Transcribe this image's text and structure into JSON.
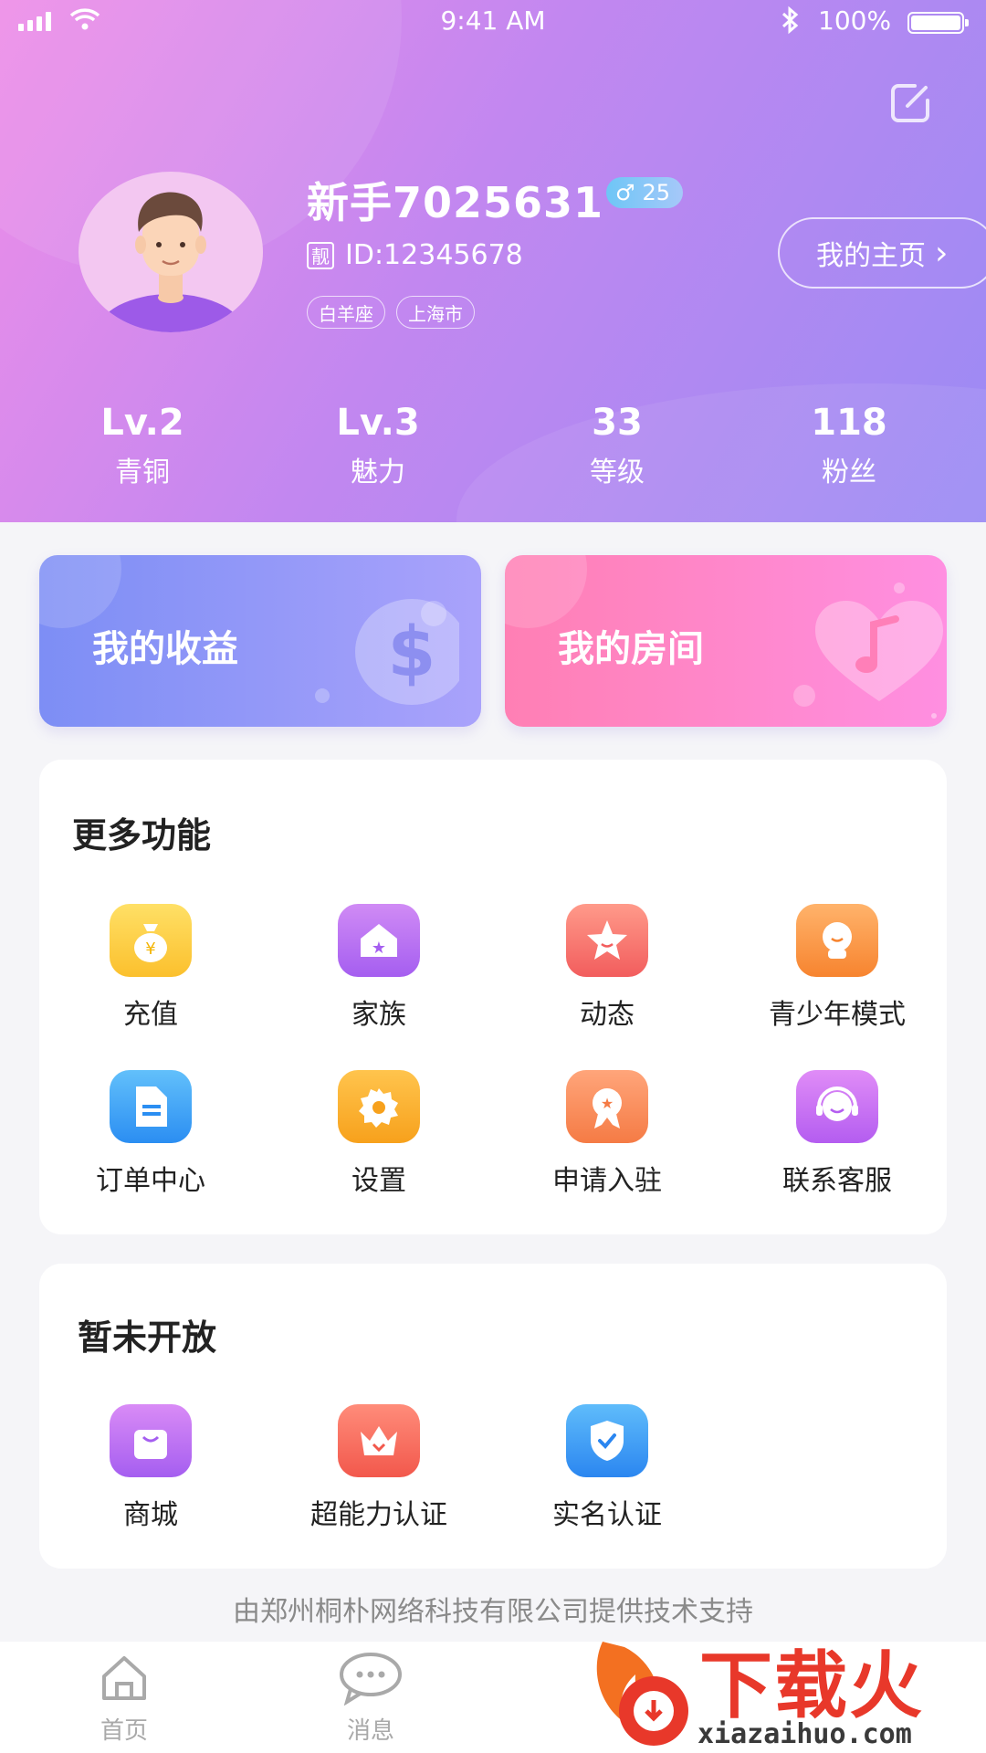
{
  "status_bar": {
    "time": "9:41 AM",
    "battery": "100%"
  },
  "profile": {
    "name": "新手7025631",
    "gender_symbol": "♂",
    "age": "25",
    "id_badge": "靓",
    "id_text": "ID:12345678",
    "tags": [
      "白羊座",
      "上海市"
    ],
    "homepage_label": "我的主页",
    "homepage_chevron": "›"
  },
  "stats": [
    {
      "value": "Lv.2",
      "label": "青铜"
    },
    {
      "value": "Lv.3",
      "label": "魅力"
    },
    {
      "value": "33",
      "label": "等级"
    },
    {
      "value": "118",
      "label": "粉丝"
    }
  ],
  "promos": {
    "earnings": "我的收益",
    "room": "我的房间"
  },
  "more_functions": {
    "title": "更多功能",
    "items": [
      {
        "label": "充值",
        "icon": "money-bag-icon"
      },
      {
        "label": "家族",
        "icon": "house-icon"
      },
      {
        "label": "动态",
        "icon": "star-icon"
      },
      {
        "label": "青少年模式",
        "icon": "youth-icon"
      },
      {
        "label": "订单中心",
        "icon": "document-icon"
      },
      {
        "label": "设置",
        "icon": "gear-icon"
      },
      {
        "label": "申请入驻",
        "icon": "medal-icon"
      },
      {
        "label": "联系客服",
        "icon": "headset-icon"
      }
    ]
  },
  "not_open": {
    "title": "暂未开放",
    "items": [
      {
        "label": "商城",
        "icon": "shopping-bag-icon"
      },
      {
        "label": "超能力认证",
        "icon": "crown-icon"
      },
      {
        "label": "实名认证",
        "icon": "shield-check-icon"
      }
    ]
  },
  "footer_note": "由郑州桐朴网络科技有限公司提供技术支持",
  "tabbar": [
    {
      "label": "首页",
      "icon": "home-icon"
    },
    {
      "label": "消息",
      "icon": "chat-icon"
    }
  ],
  "watermark": {
    "brand": "下载火",
    "url": "xiazaihuo.com"
  },
  "colors": {
    "header_start": "#ee8ee8",
    "header_end": "#9b8bf4",
    "earnings_card": "#7d8ef5",
    "room_card": "#ff7fb4"
  }
}
